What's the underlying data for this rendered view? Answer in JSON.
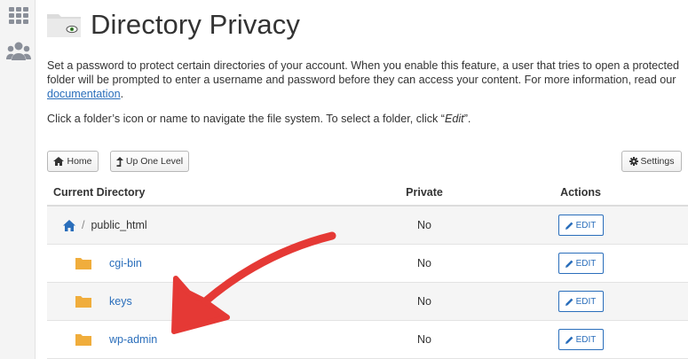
{
  "rail": {
    "icons": [
      "grid-icon",
      "users-icon"
    ],
    "color": "#8a8f99"
  },
  "page": {
    "title": "Directory Privacy",
    "description_main": "Set a password to protect certain directories of your account. When you enable this feature, a user that tries to open a protected folder will be prompted to enter a username and password before they can access your content. For more information, read our ",
    "description_link": "documentation",
    "description_end": ".",
    "nav_hint_prefix": "Click a folder’s icon or name to navigate the file system. To select a folder, click “",
    "nav_hint_em": "Edit",
    "nav_hint_suffix": "”."
  },
  "toolbar": {
    "home_label": "Home",
    "up_label": "Up One Level",
    "settings_label": "Settings"
  },
  "table": {
    "headers": {
      "directory": "Current Directory",
      "private": "Private",
      "actions": "Actions"
    },
    "current": {
      "sep": "/",
      "name": "public_html",
      "private": "No",
      "action": "EDIT"
    },
    "rows": [
      {
        "name": "cgi-bin",
        "private": "No",
        "action": "EDIT"
      },
      {
        "name": "keys",
        "private": "No",
        "action": "EDIT"
      },
      {
        "name": "wp-admin",
        "private": "No",
        "action": "EDIT"
      }
    ]
  },
  "colors": {
    "link": "#2a6ebb",
    "folder": "#f0ad3c",
    "arrow": "#e53935"
  },
  "annotation": {
    "icon": "red-arrow-icon"
  }
}
